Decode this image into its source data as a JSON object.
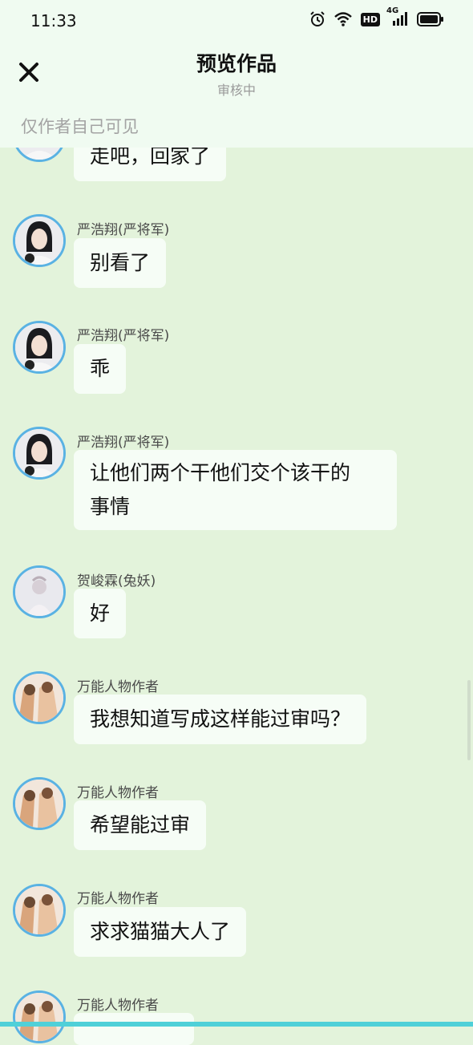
{
  "status_bar": {
    "time": "11:33",
    "hd_label": "HD",
    "network_label": "4G"
  },
  "header": {
    "title": "预览作品",
    "subtitle": "审核中",
    "visibility_note": "仅作者自己可见"
  },
  "messages": [
    {
      "name": "",
      "text": "走吧，回家了",
      "avatar": "character-a"
    },
    {
      "name": "严浩翔(严将军)",
      "text": "别看了",
      "avatar": "character-a"
    },
    {
      "name": "严浩翔(严将军)",
      "text": "乖",
      "avatar": "character-a"
    },
    {
      "name": "严浩翔(严将军)",
      "text": "让他们两个干他们交个该干的\n事情",
      "avatar": "character-a"
    },
    {
      "name": "贺峻霖(兔妖)",
      "text": "好",
      "avatar": "character-b"
    },
    {
      "name": "万能人物作者",
      "text": "我想知道写成这样能过审吗？",
      "avatar": "author"
    },
    {
      "name": "万能人物作者",
      "text": "希望能过审",
      "avatar": "author"
    },
    {
      "name": "万能人物作者",
      "text": "求求猫猫大人了",
      "avatar": "author"
    },
    {
      "name": "万能人物作者",
      "text": "",
      "avatar": "author"
    }
  ],
  "colors": {
    "background": "#e3f3db",
    "header": "#f0fbf1",
    "bubble": "#f6fdf6",
    "avatar_ring": "#5ab2e3",
    "bottom_accent": "#4fd0d8"
  }
}
